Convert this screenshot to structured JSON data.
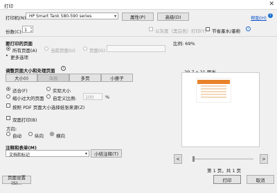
{
  "window": {
    "title": "打印"
  },
  "printer": {
    "label": "打印机(N):",
    "selected": "HP Smart Tank 580-590 series",
    "properties_button": "属性(P)",
    "advanced_button": "高级(D)",
    "help_link": "帮助(H)"
  },
  "copies": {
    "label": "份数(C):",
    "value": "1",
    "grayscale_label": "以灰度（黑白色）打印(Y)",
    "save_ink_label": "节省墨水/墨粉"
  },
  "pages_to_print": {
    "heading": "要打印的页面",
    "options": [
      "所有页面(A)",
      "当前页面(U)",
      "页面(G)"
    ],
    "more_options": "更多选项"
  },
  "sizing": {
    "heading": "调整页面大小和处理页面",
    "tabs": [
      "大小(I)",
      "海报",
      "多页",
      "小册子"
    ],
    "options": [
      "适合(F)",
      "实际大小",
      "缩小过大的页面",
      "自定义比例:"
    ],
    "custom_scale_value": "100",
    "custom_scale_unit": "%",
    "paper_source_label": "按照 PDF 页面大小选择纸张来源(Z)"
  },
  "duplex": {
    "label": "双面打印(B)"
  },
  "orientation": {
    "heading": "方向:",
    "options": [
      "自动",
      "纵向",
      "横向"
    ]
  },
  "comments": {
    "heading": "注释和表单(M)",
    "selected": "文档和标记",
    "summarize_button": "小结注释(T)"
  },
  "preview": {
    "scale_label": "比例: 69%",
    "paper_size": "29.7 x 21 厘米",
    "page_info": "第 1 页，共 1 页",
    "prev": "<",
    "next": ">"
  },
  "footer": {
    "page_setup_button": "页面设置(S)...",
    "print_button": "打印",
    "cancel_button": "取消"
  }
}
